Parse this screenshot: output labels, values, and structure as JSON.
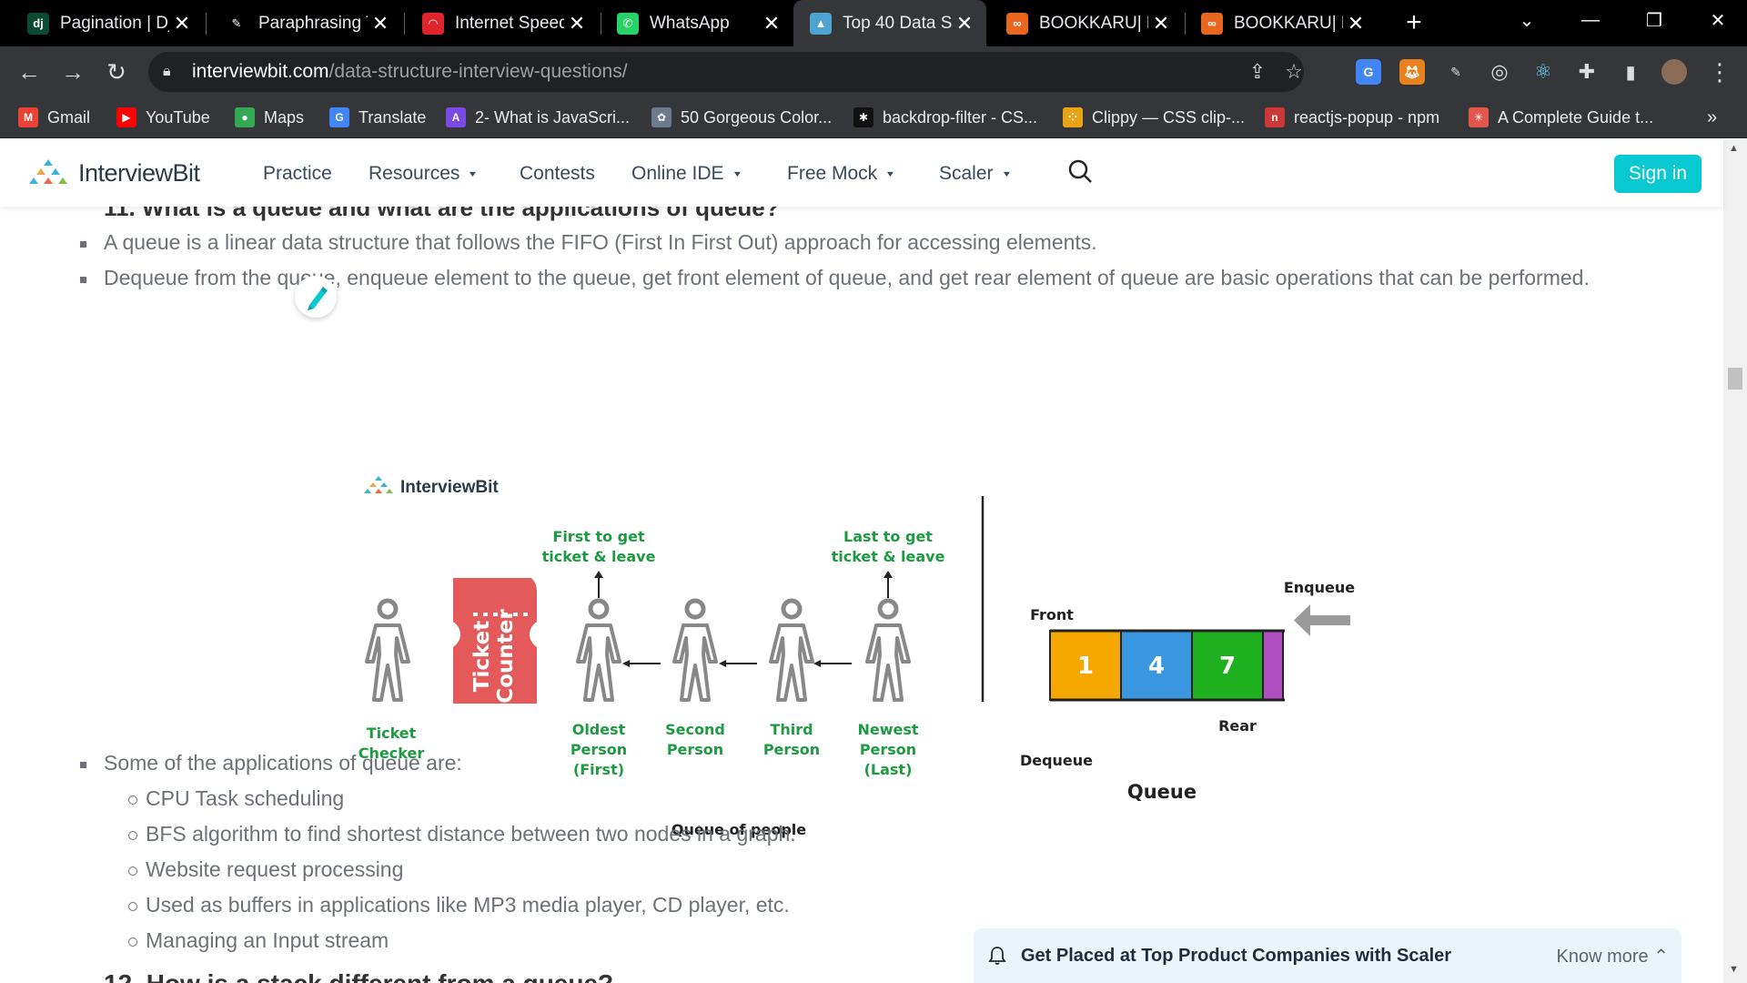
{
  "browser": {
    "tabs": [
      {
        "title": "Pagination | Dj",
        "icon": "django-icon",
        "favtext": "dj",
        "color": "#0c4b33",
        "active": false
      },
      {
        "title": "Paraphrasing T",
        "icon": "paraphrase-icon",
        "favtext": "✎",
        "color": "#000000",
        "active": false
      },
      {
        "title": "Internet Speed",
        "icon": "speed-icon",
        "favtext": "◠",
        "color": "#e0242b",
        "active": false
      },
      {
        "title": "WhatsApp",
        "icon": "whatsapp-icon",
        "favtext": "✆",
        "color": "#25d366",
        "active": false
      },
      {
        "title": "Top 40 Data St",
        "icon": "interviewbit-icon",
        "favtext": "▲",
        "color": "#4fa3d1",
        "active": true
      },
      {
        "title": "BOOKKARU| Bu",
        "icon": "bookkaru-icon",
        "favtext": "∞",
        "color": "#e8661e",
        "active": false
      },
      {
        "title": "BOOKKARU| Bu",
        "icon": "bookkaru-icon",
        "favtext": "∞",
        "color": "#e8661e",
        "active": false
      }
    ],
    "url_host": "interviewbit.com",
    "url_path": "/data-structure-interview-questions/",
    "bookmarks": [
      {
        "label": "Gmail",
        "icon": "gmail-icon",
        "favtext": "M",
        "color": "#ea4335"
      },
      {
        "label": "YouTube",
        "icon": "youtube-icon",
        "favtext": "▶",
        "color": "#ff0000"
      },
      {
        "label": "Maps",
        "icon": "maps-icon",
        "favtext": "●",
        "color": "#34a853"
      },
      {
        "label": "Translate",
        "icon": "translate-icon",
        "favtext": "G",
        "color": "#4285f4"
      },
      {
        "label": "2- What is JavaScri...",
        "icon": "js-course-icon",
        "favtext": "A",
        "color": "#7b4ae2"
      },
      {
        "label": "50 Gorgeous Color...",
        "icon": "palette-icon",
        "favtext": "✿",
        "color": "#6b7b8c"
      },
      {
        "label": "backdrop-filter - CS...",
        "icon": "csstricks-icon",
        "favtext": "✱",
        "color": "#111111"
      },
      {
        "label": "Clippy — CSS clip-...",
        "icon": "clippy-icon",
        "favtext": "⁘",
        "color": "#e8a317"
      },
      {
        "label": "reactjs-popup - npm",
        "icon": "npm-icon",
        "favtext": "n",
        "color": "#cb3837"
      },
      {
        "label": "A Complete Guide t...",
        "icon": "guide-icon",
        "favtext": "✳",
        "color": "#e2574c"
      }
    ]
  },
  "site": {
    "logo": "InterviewBit",
    "nav": [
      {
        "label": "Practice",
        "dropdown": false
      },
      {
        "label": "Resources",
        "dropdown": true
      },
      {
        "label": "Contests",
        "dropdown": false
      },
      {
        "label": "Online IDE",
        "dropdown": true
      },
      {
        "label": "Free Mock",
        "dropdown": true
      },
      {
        "label": "Scaler",
        "dropdown": true
      }
    ],
    "signin": "Sign in",
    "accent": "#08c9d1"
  },
  "article": {
    "bullets_top": [
      "A queue is a linear data structure that follows the FIFO (First In First Out) approach for accessing elements.",
      "Dequeue from the queue, enqueue element to the queue, get front element of queue, and get rear element of queue are basic operations that can be performed."
    ],
    "applications_intro": "Some of the applications of queue are:",
    "applications": [
      "CPU Task scheduling",
      "BFS algorithm to find shortest distance between two nodes in a graph.",
      "Website request processing",
      "Used as buffers in applications like MP3 media player, CD player, etc.",
      "Managing an Input stream"
    ],
    "next_heading": "12. How is a stack different from a queue?"
  },
  "diagram": {
    "brand": "InterviewBit",
    "first_label": [
      "First to get",
      "ticket & leave"
    ],
    "last_label": [
      "Last to get",
      "ticket & leave"
    ],
    "ticket_checker": [
      "Ticket",
      "Checker"
    ],
    "ticket_counter": [
      "Ticket",
      "Counter"
    ],
    "people": [
      [
        "Oldest",
        "Person",
        "(First)"
      ],
      [
        "Second",
        "Person"
      ],
      [
        "Third",
        "Person"
      ],
      [
        "Newest",
        "Person",
        "(Last)"
      ]
    ],
    "queue_of_people": "Queue of people",
    "front": "Front",
    "rear": "Rear",
    "enqueue": "Enqueue",
    "dequeue": "Dequeue",
    "queue_title": "Queue",
    "cells": [
      {
        "value": "1",
        "color": "#f5a800"
      },
      {
        "value": "4",
        "color": "#3b96e0"
      },
      {
        "value": "7",
        "color": "#1fb01f"
      },
      {
        "value": "",
        "color": "#b04fc0"
      }
    ]
  },
  "banner": {
    "message": "Get Placed at Top Product Companies with Scaler",
    "action": "Know more"
  }
}
